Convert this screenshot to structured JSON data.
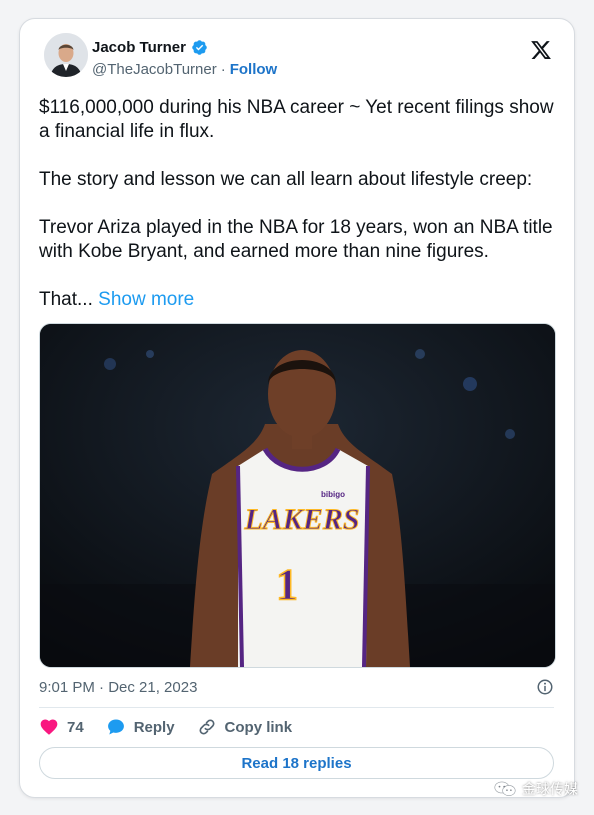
{
  "tweet": {
    "author": {
      "name": "Jacob Turner",
      "handle": "@TheJacobTurner",
      "separator": "·",
      "follow_label": "Follow",
      "verified": true
    },
    "text": {
      "p1": "$116,000,000 during his NBA career ~ Yet recent filings show a financial life in flux.",
      "p2": "The story and lesson we can all learn about lifestyle creep:",
      "p3": "Trevor Ariza played in the NBA for 18 years, won an NBA title with Kobe Bryant, and earned more than nine figures.",
      "p4_prefix": "That... ",
      "show_more": "Show more"
    },
    "media": {
      "jersey_team": "LAKERS",
      "jersey_number": "1",
      "jersey_sponsor": "bibigo"
    },
    "timestamp": "9:01 PM · Dec 21, 2023",
    "actions": {
      "like_count": "74",
      "reply_label": "Reply",
      "copy_link_label": "Copy link"
    },
    "read_replies_label": "Read 18 replies"
  },
  "watermark": "金球传媒",
  "colors": {
    "accent": "#1d9bf0",
    "link": "#1d74c9",
    "like": "#f91880",
    "verified": "#1d9bf0",
    "secondary_text": "#536471"
  },
  "icons": [
    "verified-badge-icon",
    "x-logo-icon",
    "info-icon",
    "heart-icon",
    "reply-bubble-icon",
    "link-icon",
    "wechat-icon"
  ]
}
